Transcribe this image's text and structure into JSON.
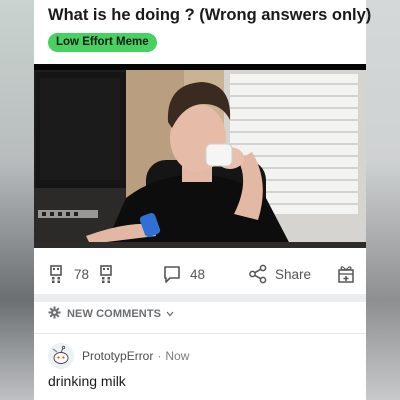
{
  "post": {
    "title": "What is he doing ? (Wrong answers only)",
    "flair": "Low Effort Meme",
    "flair_color": "#46d160"
  },
  "actions": {
    "vote_count": "78",
    "comment_count": "48",
    "share_label": "Share",
    "upvote_icon": "upvote-icon",
    "downvote_icon": "downvote-icon",
    "comment_icon": "comment-icon",
    "share_icon": "share-icon",
    "award_icon": "award-icon"
  },
  "comments_sort": {
    "label": "NEW COMMENTS",
    "icon": "sort-icon"
  },
  "comments": [
    {
      "username": "PrototypError",
      "separator": "·",
      "time": "Now",
      "body": "drinking milk"
    }
  ]
}
